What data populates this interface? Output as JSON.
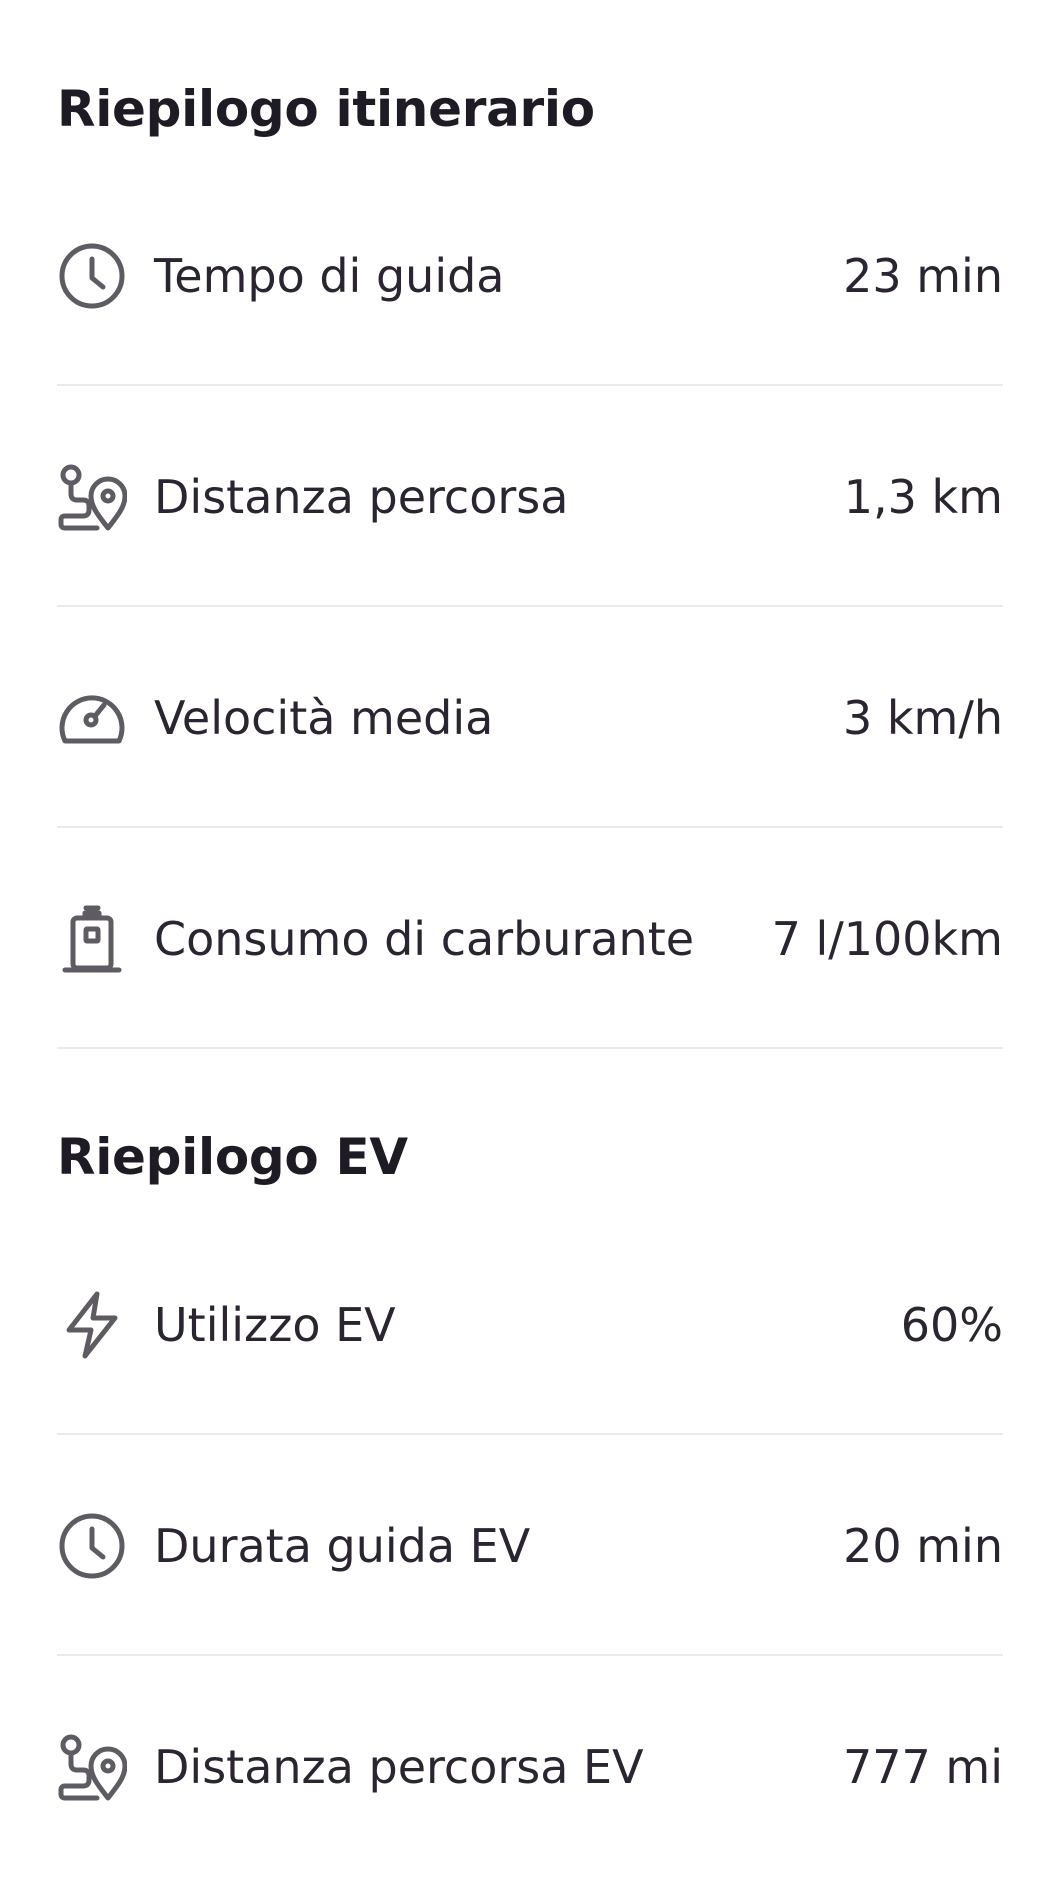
{
  "trip_summary": {
    "title": "Riepilogo itinerario",
    "rows": [
      {
        "icon": "clock-icon",
        "label": "Tempo di guida",
        "value": "23 min"
      },
      {
        "icon": "route-pin-icon",
        "label": "Distanza percorsa",
        "value": "1,3 km"
      },
      {
        "icon": "speedometer-icon",
        "label": "Velocità media",
        "value": "3 km/h"
      },
      {
        "icon": "fuel-pump-icon",
        "label": "Consumo di carburante",
        "value": "7 l/100km"
      }
    ]
  },
  "ev_summary": {
    "title": "Riepilogo EV",
    "rows": [
      {
        "icon": "lightning-icon",
        "label": "Utilizzo EV",
        "value": "60%"
      },
      {
        "icon": "clock-icon",
        "label": "Durata guida EV",
        "value": "20 min"
      },
      {
        "icon": "route-pin-icon",
        "label": "Distanza percorsa EV",
        "value": "777 mi"
      }
    ]
  },
  "colors": {
    "text": "#2a2530",
    "title": "#1f1b24",
    "icon": "#5f5b63",
    "divider": "#ebe9ee",
    "background": "#ffffff"
  }
}
